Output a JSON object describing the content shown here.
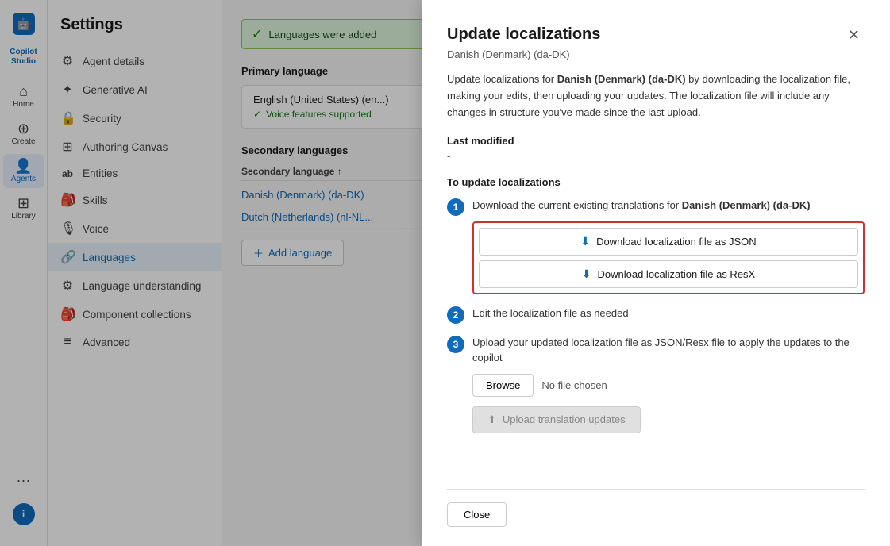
{
  "app": {
    "name": "Copilot Studio",
    "logo_icon": "🤖"
  },
  "nav": {
    "items": [
      {
        "id": "home",
        "label": "Home",
        "icon": "⌂",
        "active": false
      },
      {
        "id": "create",
        "label": "Create",
        "icon": "⊕",
        "active": false
      },
      {
        "id": "agents",
        "label": "Agents",
        "icon": "👤",
        "active": true
      },
      {
        "id": "library",
        "label": "Library",
        "icon": "⊞",
        "active": false
      }
    ],
    "more_icon": "···",
    "info_label": "i"
  },
  "sidebar": {
    "title": "Settings",
    "items": [
      {
        "id": "agent-details",
        "label": "Agent details",
        "icon": "⚙"
      },
      {
        "id": "generative-ai",
        "label": "Generative AI",
        "icon": "✦"
      },
      {
        "id": "security",
        "label": "Security",
        "icon": "🔒"
      },
      {
        "id": "authoring-canvas",
        "label": "Authoring Canvas",
        "icon": "⊞"
      },
      {
        "id": "entities",
        "label": "Entities",
        "icon": "ab"
      },
      {
        "id": "skills",
        "label": "Skills",
        "icon": "🎒"
      },
      {
        "id": "voice",
        "label": "Voice",
        "icon": "🎙"
      },
      {
        "id": "languages",
        "label": "Languages",
        "icon": "🔗",
        "active": true
      },
      {
        "id": "language-understanding",
        "label": "Language understanding",
        "icon": "⚙"
      },
      {
        "id": "component-collections",
        "label": "Component collections",
        "icon": "🎒"
      },
      {
        "id": "advanced",
        "label": "Advanced",
        "icon": "≡"
      }
    ]
  },
  "main": {
    "banner": {
      "text": "Languages were added",
      "icon": "✓"
    },
    "primary_language": {
      "section_label": "Primary language",
      "name": "English (United States) (en...)",
      "badge": "Voice features supported"
    },
    "secondary_languages": {
      "section_label": "Secondary languages",
      "column_header": "Secondary language ↑",
      "languages": [
        {
          "name": "Danish (Denmark) (da-DK)"
        },
        {
          "name": "Dutch (Netherlands) (nl-NL..."
        }
      ],
      "add_button": "+ Add language"
    }
  },
  "modal": {
    "title": "Update localizations",
    "subtitle": "Danish (Denmark) (da-DK)",
    "description_prefix": "Update localizations for ",
    "description_bold": "Danish (Denmark) (da-DK)",
    "description_suffix": " by downloading the localization file, making your edits, then uploading your updates. The localization file will include any changes in structure you've made since the last upload.",
    "last_modified_label": "Last modified",
    "last_modified_value": "-",
    "to_update_label": "To update localizations",
    "steps": [
      {
        "num": "1",
        "text_prefix": "Download the current existing translations for ",
        "text_bold": "Danish (Denmark) (da-DK)",
        "text_suffix": ""
      },
      {
        "num": "2",
        "text": "Edit the localization file as needed"
      },
      {
        "num": "3",
        "text": "Upload your updated localization file as JSON/Resx file to apply the updates to the copilot"
      }
    ],
    "download_json_label": "Download localization file as JSON",
    "download_resx_label": "Download localization file as ResX",
    "browse_label": "Browse",
    "no_file_label": "No file chosen",
    "upload_label": "Upload translation updates",
    "close_label": "Close",
    "download_icon": "⬇",
    "upload_icon": "⬆"
  }
}
